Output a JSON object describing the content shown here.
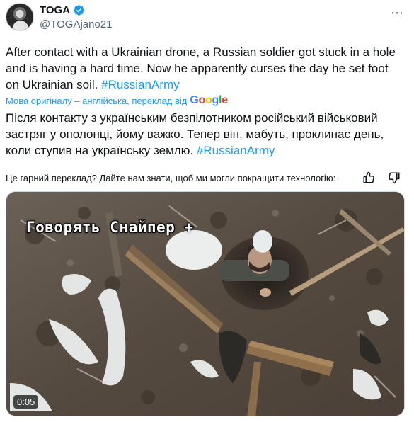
{
  "author": {
    "display_name": "TOGA",
    "handle": "@TOGAjano21"
  },
  "more_icon": "ellipsis-icon",
  "tweet": {
    "text_before_tag": "After contact with a Ukrainian drone, a Russian soldier got stuck in a hole and is having a hard time. Now he apparently curses the day he set foot on Ukrainian soil. ",
    "hashtag": "#RussianArmy"
  },
  "translation": {
    "label": "Мова оригіналу – англійська, переклад від",
    "provider": "Google",
    "text_before_tag": "Після контакту з українським безпілотником російський військовий застряг у ополонці, йому важко. Тепер він, мабуть, проклинає день, коли ступив на українську землю. ",
    "hashtag": "#RussianArmy"
  },
  "feedback": {
    "prompt": "Це гарний переклад? Дайте нам знати, щоб ми могли покращити технологію:",
    "like_icon": "thumbs-up-icon",
    "dislike_icon": "thumbs-down-icon"
  },
  "media": {
    "caption": "Говорять Снайпер +",
    "timestamp": "0:05"
  },
  "colors": {
    "accent": "#1d9bf0",
    "text": "#0f1419",
    "secondary": "#536471"
  }
}
